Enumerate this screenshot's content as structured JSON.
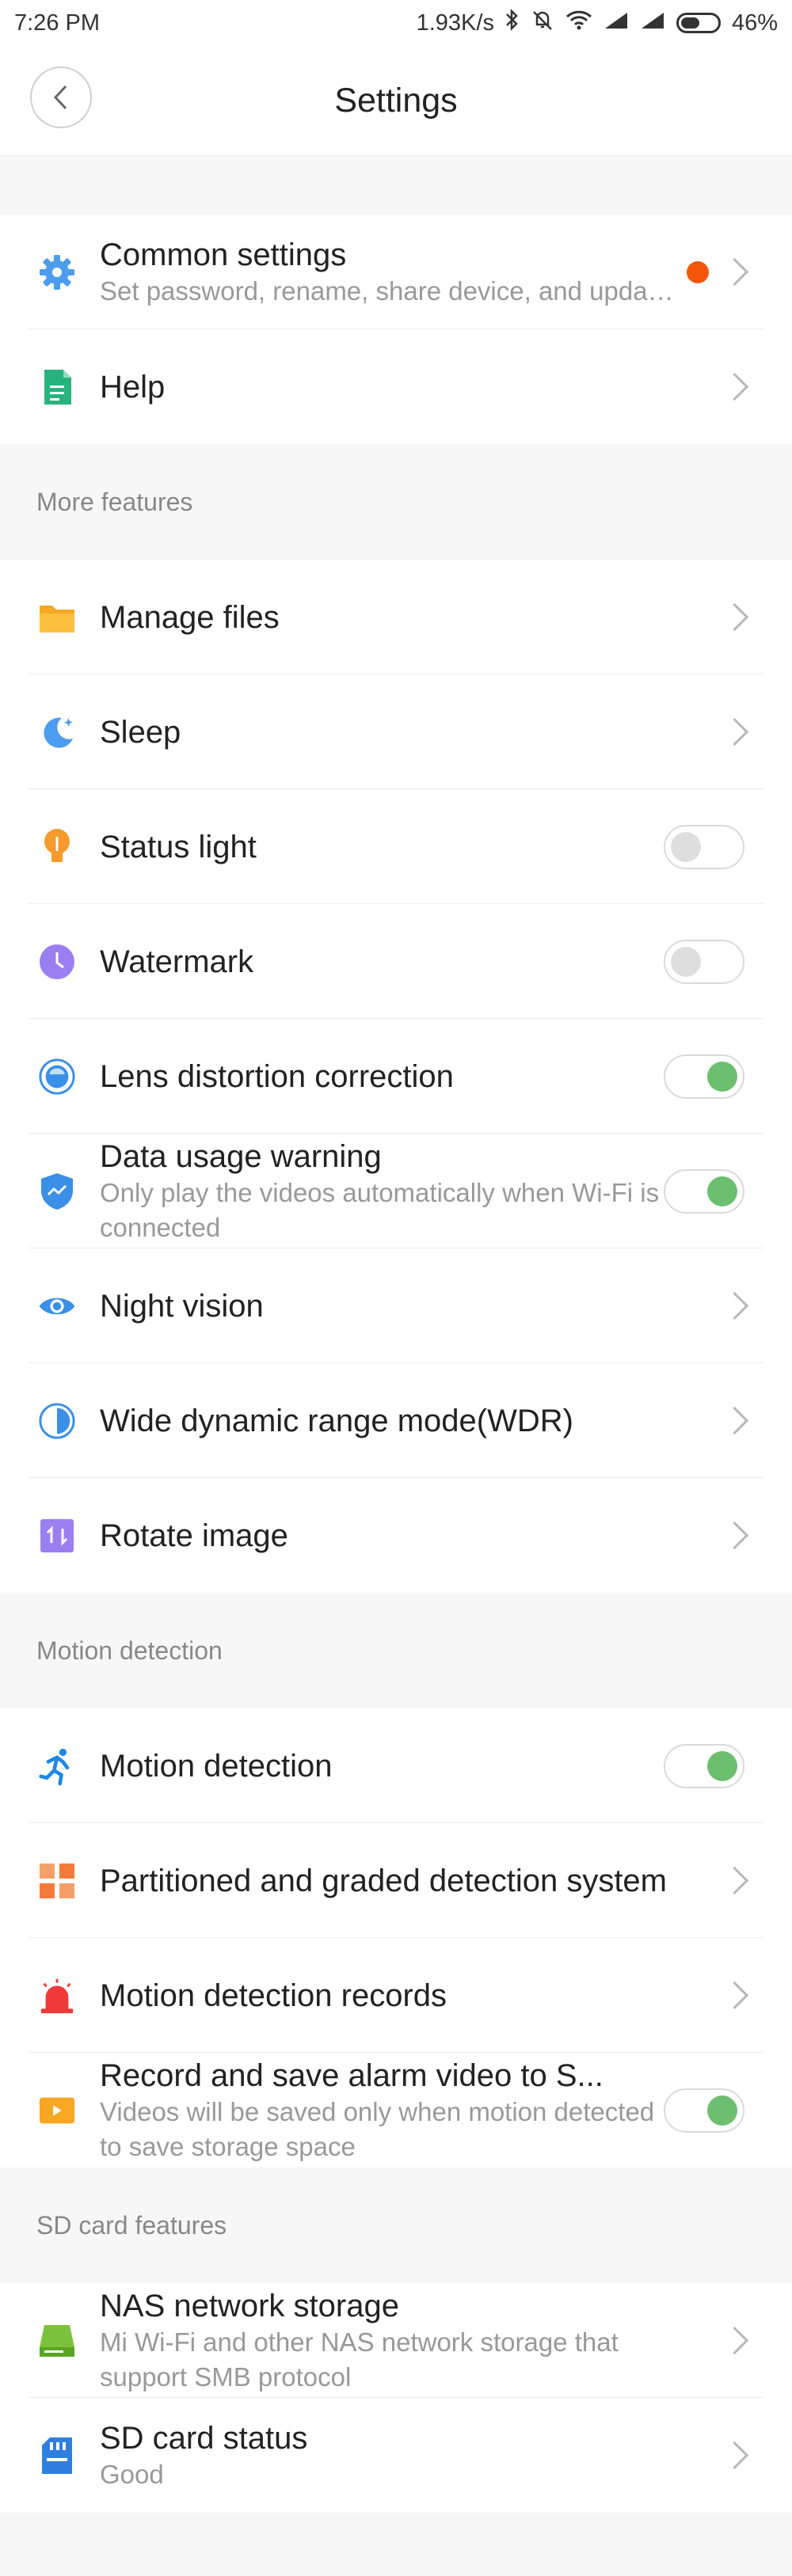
{
  "status_bar": {
    "time": "7:26 PM",
    "speed": "1.93K/s",
    "battery": "46%"
  },
  "header": {
    "title": "Settings"
  },
  "group1": [
    {
      "label": "Common settings",
      "sub": "Set password, rename, share device, and update fir..",
      "icon": "gear-icon",
      "control": "chevron",
      "dot": true
    },
    {
      "label": "Help",
      "icon": "document-icon",
      "control": "chevron"
    }
  ],
  "more_features": {
    "title": "More features",
    "items": [
      {
        "label": "Manage files",
        "icon": "folder-icon",
        "control": "chevron"
      },
      {
        "label": "Sleep",
        "icon": "moon-icon",
        "control": "chevron"
      },
      {
        "label": "Status light",
        "icon": "bulb-icon",
        "control": "toggle",
        "on": false
      },
      {
        "label": "Watermark",
        "icon": "clock-icon",
        "control": "toggle",
        "on": false
      },
      {
        "label": "Lens distortion correction",
        "icon": "lens-icon",
        "control": "toggle",
        "on": true
      },
      {
        "label": "Data usage warning",
        "sub": "Only play the videos automatically when Wi-Fi is connected",
        "icon": "shield-icon",
        "control": "toggle",
        "on": true
      },
      {
        "label": "Night vision",
        "icon": "eye-icon",
        "control": "chevron"
      },
      {
        "label": "Wide dynamic range mode(WDR)",
        "icon": "half-circle-icon",
        "control": "chevron"
      },
      {
        "label": "Rotate image",
        "icon": "rotate-icon",
        "control": "chevron"
      }
    ]
  },
  "motion_detection": {
    "title": "Motion detection",
    "items": [
      {
        "label": "Motion detection",
        "icon": "running-icon",
        "control": "toggle",
        "on": true
      },
      {
        "label": "Partitioned and graded detection system",
        "icon": "grid-icon",
        "control": "chevron"
      },
      {
        "label": "Motion detection records",
        "icon": "alarm-icon",
        "control": "chevron"
      },
      {
        "label": "Record and save alarm video to S...",
        "sub": "Videos will be saved only when motion detected to save storage space",
        "icon": "video-icon",
        "control": "toggle",
        "on": true
      }
    ]
  },
  "sd_card": {
    "title": "SD card features",
    "items": [
      {
        "label": "NAS network storage",
        "sub": "Mi Wi-Fi and other NAS network storage that support SMB protocol",
        "icon": "nas-icon",
        "control": "chevron"
      },
      {
        "label": "SD card status",
        "sub": "Good",
        "icon": "sd-card-icon",
        "control": "chevron"
      }
    ]
  },
  "colors": {
    "toggle_on": "#6cbf6f",
    "badge": "#f5550b"
  }
}
